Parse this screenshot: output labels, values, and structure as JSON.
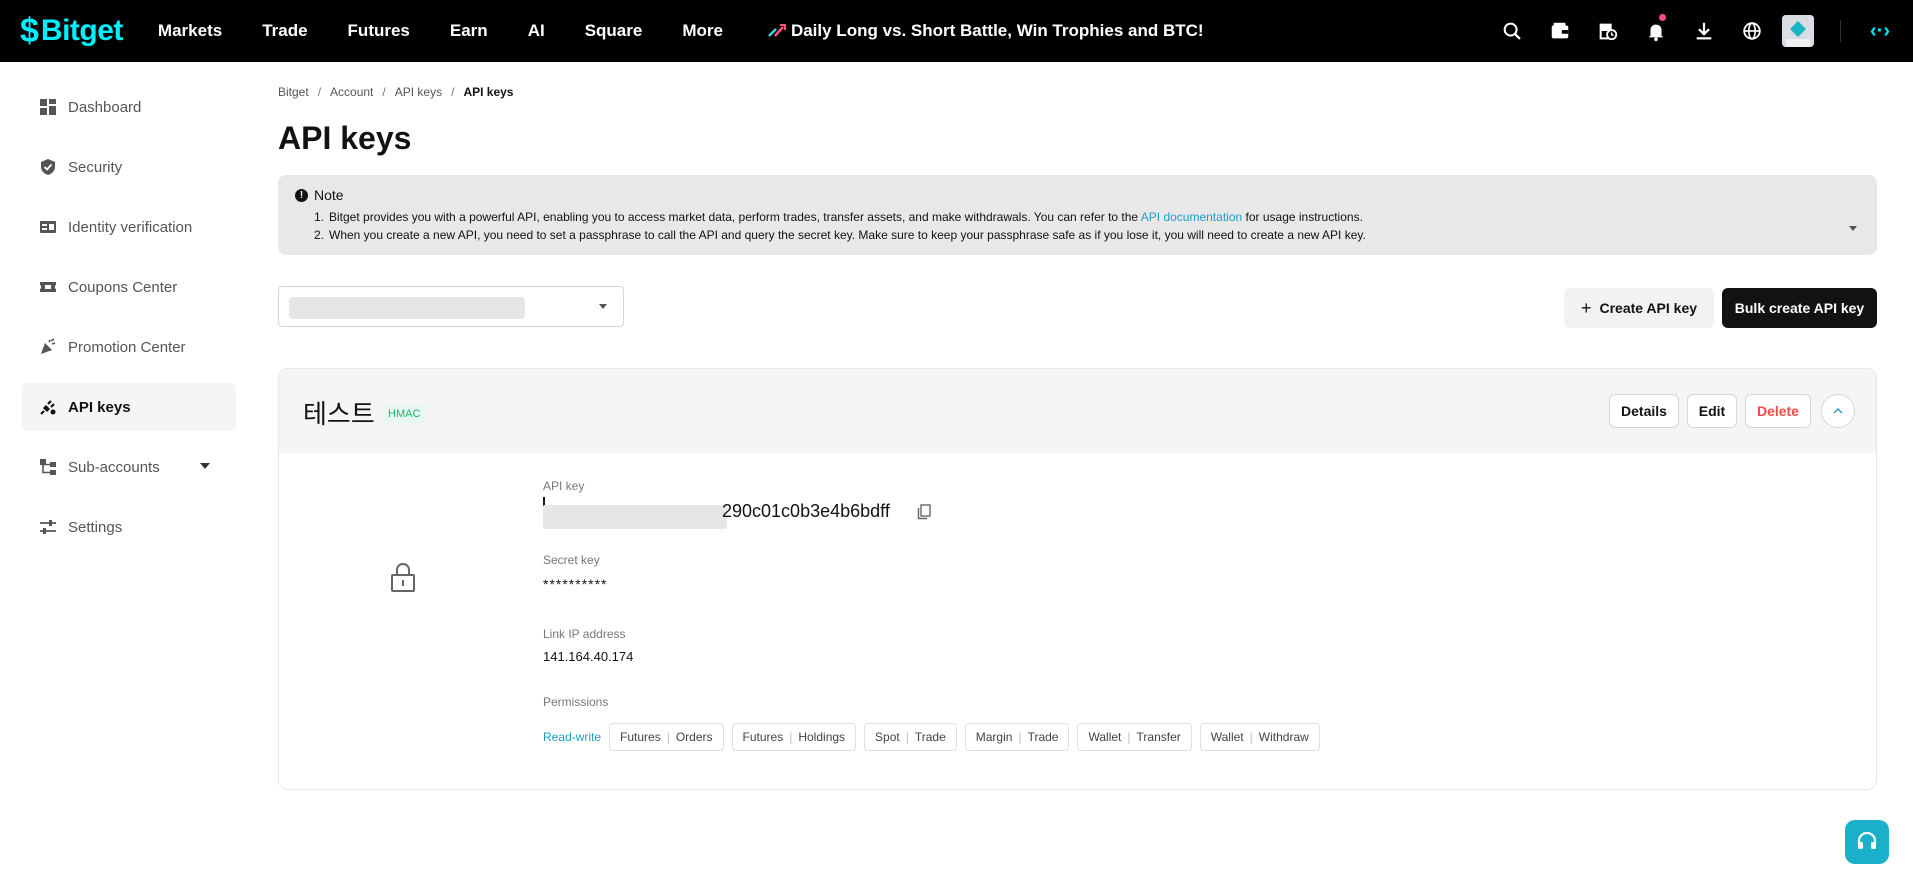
{
  "brand": {
    "name": "Bitget",
    "accent": "#00f0ff"
  },
  "nav": {
    "items": [
      "Markets",
      "Trade",
      "Futures",
      "Earn",
      "AI",
      "Square",
      "More"
    ],
    "promo": "Daily Long vs. Short Battle, Win Trophies and BTC!",
    "icons": [
      "search-icon",
      "wallet-icon",
      "history-icon",
      "bell-icon",
      "download-icon",
      "globe-icon"
    ]
  },
  "sidebar": {
    "items": [
      {
        "label": "Dashboard",
        "icon": "dashboard-icon"
      },
      {
        "label": "Security",
        "icon": "shield-icon"
      },
      {
        "label": "Identity verification",
        "icon": "id-card-icon"
      },
      {
        "label": "Coupons Center",
        "icon": "ticket-icon"
      },
      {
        "label": "Promotion Center",
        "icon": "party-icon"
      },
      {
        "label": "API keys",
        "icon": "plug-icon",
        "active": true
      },
      {
        "label": "Sub-accounts",
        "icon": "tree-icon"
      },
      {
        "label": "Settings",
        "icon": "sliders-icon"
      }
    ]
  },
  "breadcrumb": [
    "Bitget",
    "Account",
    "API keys",
    "API keys"
  ],
  "page": {
    "title": "API keys"
  },
  "note": {
    "title": "Note",
    "line1_prefix": "Bitget provides you with a powerful API, enabling you to access market data, perform trades, transfer assets, and make withdrawals. You can refer to the",
    "line1_link": "API documentation",
    "line1_suffix": "for usage instructions.",
    "line2": "When you create a new API, you need to set a passphrase to call the API and query the secret key. Make sure to keep your passphrase safe as if you lose it, you will need to create a new API key."
  },
  "actions": {
    "create": "Create API key",
    "bulk": "Bulk create API key"
  },
  "apikey": {
    "name": "테스트",
    "type": "HMAC",
    "buttons": {
      "details": "Details",
      "edit": "Edit",
      "delete": "Delete"
    },
    "api_key_label": "API key",
    "api_key_suffix": "290c01c0b3e4b6bdff",
    "secret_label": "Secret key",
    "secret_value": "**********",
    "ip_label": "Link IP address",
    "ip_value": "141.164.40.174",
    "permissions_label": "Permissions",
    "permission_mode": "Read-write",
    "permissions": [
      {
        "group": "Futures",
        "right": "Orders"
      },
      {
        "group": "Futures",
        "right": "Holdings"
      },
      {
        "group": "Spot",
        "right": "Trade"
      },
      {
        "group": "Margin",
        "right": "Trade"
      },
      {
        "group": "Wallet",
        "right": "Transfer"
      },
      {
        "group": "Wallet",
        "right": "Withdraw"
      }
    ]
  }
}
